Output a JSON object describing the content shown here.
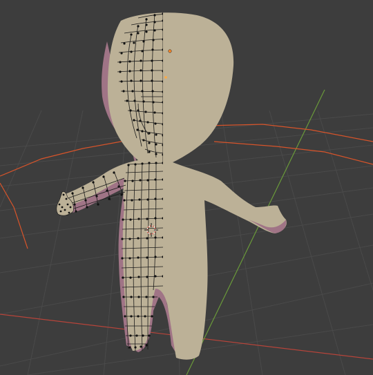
{
  "viewport": {
    "background_color": "#3d3d3d",
    "grid_color": "#4a4a4a",
    "x_axis_color": "#c24a2e",
    "y_axis_color": "#6a9a3a",
    "object_outline_color": "#ff6a33",
    "mesh_fill_color": "#bdb198",
    "mesh_shadow_color": "#9a6a80",
    "vertex_color": "#111111",
    "edge_color": "#1a1a1a"
  },
  "object": {
    "name_icon": "character-mesh-icon",
    "mode": "edit",
    "mirror": true
  },
  "gizmos": {
    "origin_icon": "object-origin-icon",
    "cursor_icon": "3d-cursor-icon"
  }
}
